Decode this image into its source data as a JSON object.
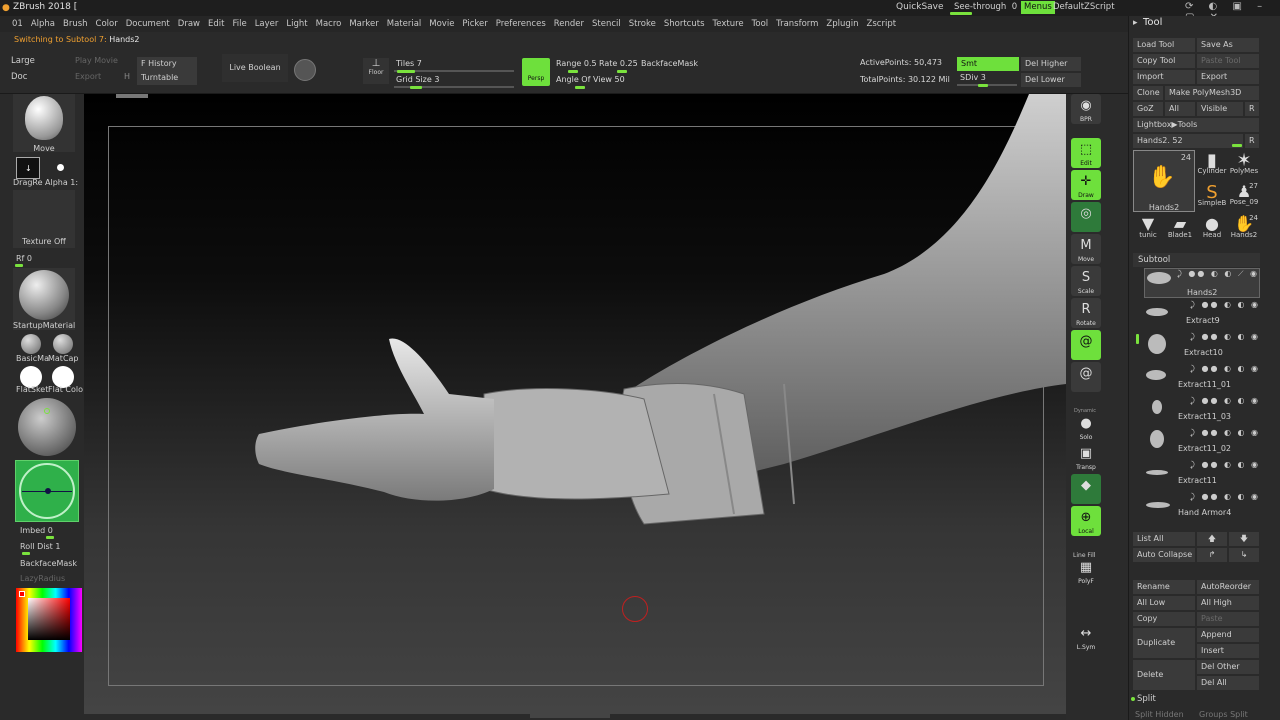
{
  "title_bar": {
    "app": "ZBrush 2018 [",
    "quicksave": "QuickSave",
    "seethrough": "See-through",
    "seethrough_val": "0",
    "menus": "Menus",
    "script": "DefaultZScript"
  },
  "menu": [
    "01",
    "Alpha",
    "Brush",
    "Color",
    "Document",
    "Draw",
    "Edit",
    "File",
    "Layer",
    "Light",
    "Macro",
    "Marker",
    "Material",
    "Movie",
    "Picker",
    "Preferences",
    "Render",
    "Stencil",
    "Stroke",
    "Shortcuts",
    "Texture",
    "Tool",
    "Transform",
    "Zplugin",
    "Zscript"
  ],
  "status": {
    "prefix": "Switching to Subtool 7:",
    "name": "Hands2"
  },
  "top": {
    "large": "Large",
    "doc": "Doc",
    "play_movie": "Play Movie",
    "export": "Export",
    "h": "H",
    "f_history": "F History",
    "turntable": "Turntable",
    "live_boolean": "Live Boolean",
    "floor": "Floor",
    "tiles": "Tiles",
    "tiles_val": "7",
    "tiles_fill": 0.15,
    "grid": "Grid Size",
    "grid_val": "3",
    "grid_fill": 0.2,
    "persp": "Persp",
    "range": "Range",
    "range_val": "0.5",
    "rate": "Rate",
    "rate_val": "0.25",
    "angle": "Angle Of View",
    "angle_val": "50",
    "backface": "BackfaceMask",
    "active_points": "ActivePoints: 50,473",
    "total_points": "TotalPoints: 30.122 Mil",
    "smt": "Smt",
    "sdiv": "SDiv",
    "sdiv_val": "3",
    "sdiv_fill": 0.45,
    "del_higher": "Del Higher",
    "del_lower": "Del Lower"
  },
  "left": {
    "brush": "Move",
    "stroke": "DragRe",
    "alpha": "Alpha 1:",
    "texture": "Texture Off",
    "rf": "Rf",
    "rf_val": "0",
    "material": "StartupMaterial",
    "mat1": "BasicMa",
    "mat2": "MatCap",
    "mat3": "FlatSket",
    "mat4": "Flat Colo",
    "imbed": "Imbed",
    "imbed_val": "0",
    "roll": "Roll Dist",
    "roll_val": "1",
    "backface": "BackfaceMask",
    "lazy": "LazyRadius"
  },
  "right_icons": [
    {
      "name": "bpr",
      "label": "BPR"
    },
    {
      "name": "edit",
      "label": "Edit"
    },
    {
      "name": "draw",
      "label": "Draw"
    },
    {
      "name": "move",
      "label": "Move"
    },
    {
      "name": "scale",
      "label": "Scale"
    },
    {
      "name": "rotate",
      "label": "Rotate"
    },
    {
      "name": "solo",
      "label": "Solo"
    },
    {
      "name": "transp",
      "label": "Transp"
    },
    {
      "name": "local",
      "label": "Local"
    },
    {
      "name": "polyf",
      "label": "PolyF"
    },
    {
      "name": "lsym",
      "label": "L.Sym"
    }
  ],
  "right_small": {
    "dynamic": "Dynamic",
    "line_fill": "Line Fill"
  },
  "panel": {
    "title": "Tool",
    "load": "Load Tool",
    "save": "Save As",
    "copy_tool": "Copy Tool",
    "paste_tool": "Paste Tool",
    "import": "Import",
    "export": "Export",
    "clone": "Clone",
    "make_poly": "Make PolyMesh3D",
    "goz": "GoZ",
    "all": "All",
    "visible": "Visible",
    "r": "R",
    "lightbox": "Lightbox▶Tools",
    "hands_slider": "Hands2. 52",
    "thumbs": [
      {
        "label": "Hands2",
        "count": "24"
      },
      {
        "label": "Cylinder"
      },
      {
        "label": "PolyMes"
      },
      {
        "label": "SimpleB"
      },
      {
        "label": "Pose_09",
        "count": "27"
      },
      {
        "label": "tunic"
      },
      {
        "label": "Blade1"
      },
      {
        "label": "Head"
      },
      {
        "label": "Hands2",
        "count": "24"
      }
    ],
    "subtool": "Subtool",
    "subtools": [
      "Hands2",
      "Extract9",
      "Extract10",
      "Extract11_01",
      "Extract11_03",
      "Extract11_02",
      "Extract11",
      "Hand Armor4"
    ],
    "list_all": "List All",
    "auto_collapse": "Auto Collapse",
    "rename": "Rename",
    "autoreorder": "AutoReorder",
    "all_low": "All Low",
    "all_high": "All High",
    "copy": "Copy",
    "paste": "Paste",
    "duplicate": "Duplicate",
    "append": "Append",
    "insert": "Insert",
    "delete": "Delete",
    "del_other": "Del Other",
    "del_all": "Del All",
    "split": "Split",
    "split_hidden": "Split Hidden",
    "groups_split": "Groups Split"
  },
  "colors": {
    "accent": "#6ee03c",
    "panel": "#2a2a2a",
    "button": "#3a3a3a"
  }
}
